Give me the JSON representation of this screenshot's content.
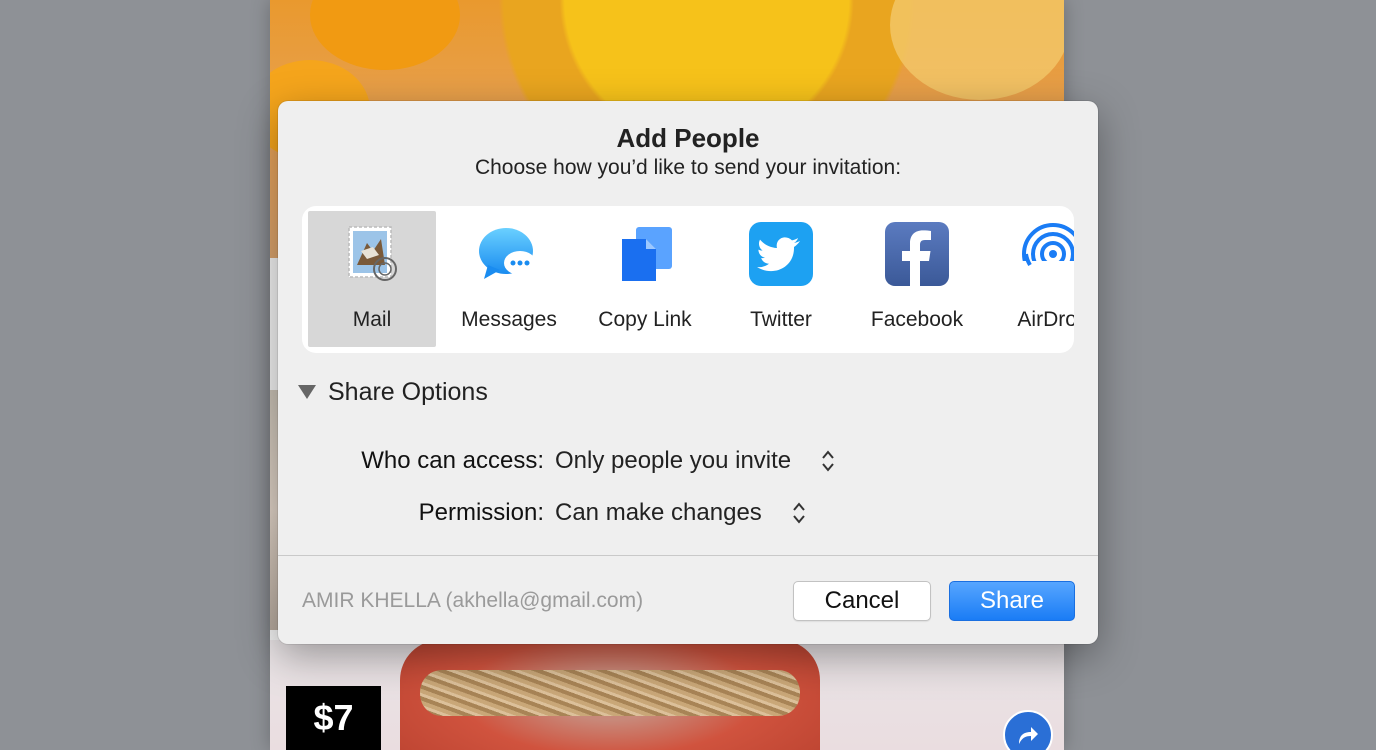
{
  "background": {
    "price": "$7"
  },
  "dialog": {
    "title": "Add People",
    "subtitle": "Choose how you’d like to send your invitation:",
    "services": [
      {
        "label": "Mail",
        "icon": "mail-stamp-icon",
        "selected": true
      },
      {
        "label": "Messages",
        "icon": "messages-icon",
        "selected": false
      },
      {
        "label": "Copy Link",
        "icon": "copy-link-icon",
        "selected": false
      },
      {
        "label": "Twitter",
        "icon": "twitter-icon",
        "selected": false
      },
      {
        "label": "Facebook",
        "icon": "facebook-icon",
        "selected": false
      },
      {
        "label": "AirDrop",
        "icon": "airdrop-icon",
        "selected": false
      }
    ],
    "share_options": {
      "label": "Share Options",
      "expanded": true,
      "who_can_access": {
        "label": "Who can access:",
        "value": "Only people you invite"
      },
      "permission": {
        "label": "Permission:",
        "value": "Can make changes"
      }
    },
    "account": "AMIR KHELLA (akhella@gmail.com)",
    "cancel_label": "Cancel",
    "share_label": "Share"
  },
  "colors": {
    "accent": "#1a7cf5",
    "twitter": "#1da1f2",
    "facebook": "#3b5998",
    "dialog_bg": "#efefef"
  }
}
